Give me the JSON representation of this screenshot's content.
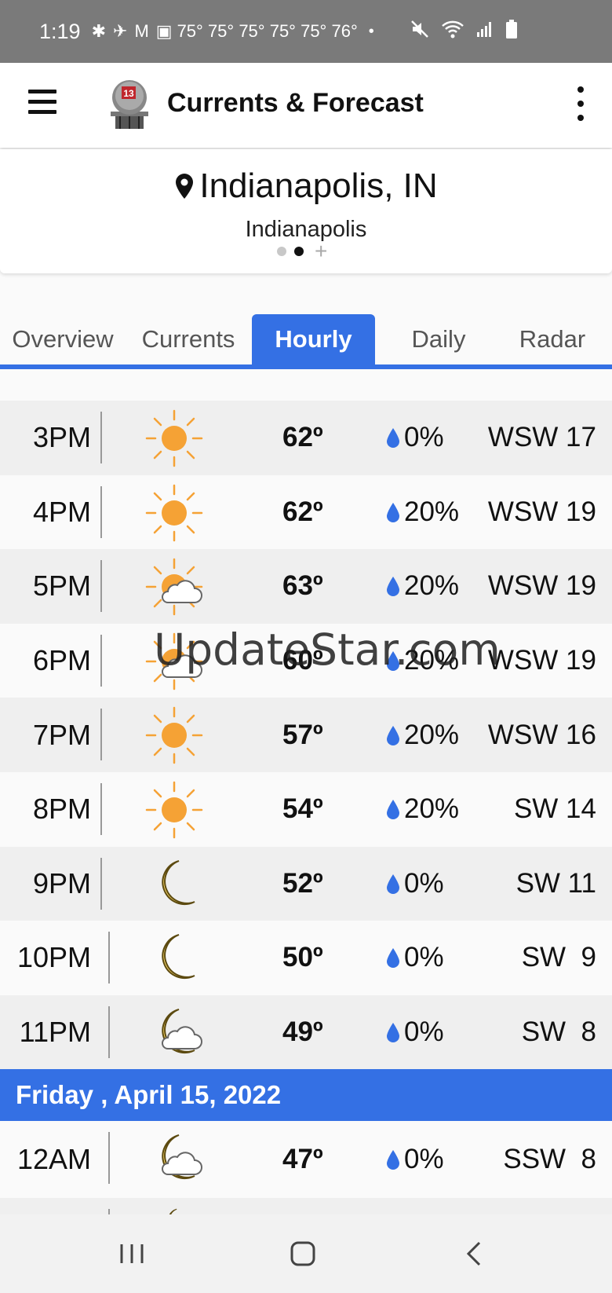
{
  "status_bar": {
    "time": "1:19",
    "temps": "75° 75° 75° 75° 75° 76°",
    "bullet": "•"
  },
  "app_bar": {
    "logo_text": "13",
    "title": "Currents & Forecast"
  },
  "location": {
    "city": "Indianapolis, IN",
    "subtitle": "Indianapolis"
  },
  "tabs": [
    {
      "label": "Overview"
    },
    {
      "label": "Currents"
    },
    {
      "label": "Hourly"
    },
    {
      "label": "Daily"
    },
    {
      "label": "Radar"
    }
  ],
  "hourly": [
    {
      "time": "3PM",
      "icon": "sun-icon",
      "temp": "62º",
      "precip": "0%",
      "wind": "WSW 17"
    },
    {
      "time": "4PM",
      "icon": "sun-icon",
      "temp": "62º",
      "precip": "20%",
      "wind": "WSW 19"
    },
    {
      "time": "5PM",
      "icon": "partly-cloudy-icon",
      "temp": "63º",
      "precip": "20%",
      "wind": "WSW 19"
    },
    {
      "time": "6PM",
      "icon": "partly-cloudy-icon",
      "temp": "60º",
      "precip": "20%",
      "wind": "WSW 19"
    },
    {
      "time": "7PM",
      "icon": "sun-icon",
      "temp": "57º",
      "precip": "20%",
      "wind": "WSW 16"
    },
    {
      "time": "8PM",
      "icon": "sun-icon",
      "temp": "54º",
      "precip": "20%",
      "wind": "SW 14"
    },
    {
      "time": "9PM",
      "icon": "moon-icon",
      "temp": "52º",
      "precip": "0%",
      "wind": "SW 11"
    },
    {
      "time": "10PM",
      "icon": "moon-icon",
      "temp": "50º",
      "precip": "0%",
      "wind": "SW  9"
    },
    {
      "time": "11PM",
      "icon": "moon-cloud-icon",
      "temp": "49º",
      "precip": "0%",
      "wind": "SW  8"
    }
  ],
  "day_header": "Friday , April 15, 2022",
  "next_day": [
    {
      "time": "12AM",
      "icon": "moon-cloud-icon",
      "temp": "47º",
      "precip": "0%",
      "wind": "SSW  8"
    }
  ],
  "watermark": "UpdateStar.com",
  "colors": {
    "accent": "#3470e4",
    "sun": "#f5a235",
    "moon": "#f7d66a",
    "drop": "#3470e4"
  }
}
